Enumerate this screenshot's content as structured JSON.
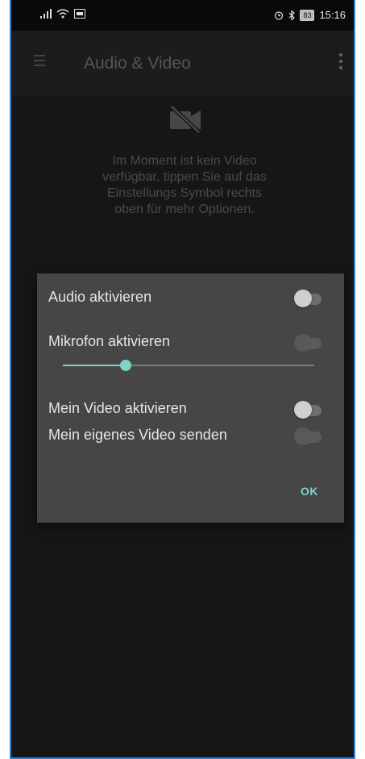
{
  "status_bar": {
    "time": "15:16",
    "battery": "83",
    "signal_icon": "signal-icon",
    "wifi_icon": "wifi-icon",
    "alarm_icon": "alarm-icon",
    "bluetooth_icon": "bluetooth-icon"
  },
  "app_bar": {
    "title": "Audio & Video"
  },
  "main": {
    "message": "Im Moment ist kein Video verfügbar, tippen Sie auf das Einstellungs Symbol rechts oben für mehr Optionen."
  },
  "dialog": {
    "audio_label": "Audio aktivieren",
    "audio_on": false,
    "mic_label": "Mikrofon aktivieren",
    "mic_on": false,
    "mic_enabled": false,
    "mic_volume": 0.25,
    "video_label": "Mein Video aktivieren",
    "video_on": false,
    "send_video_label": "Mein eigenes Video senden",
    "send_video_on": false,
    "send_video_enabled": false,
    "ok_label": "OK"
  },
  "colors": {
    "accent": "#7fd3c7",
    "dialog_bg": "#464646",
    "background": "#161616"
  }
}
